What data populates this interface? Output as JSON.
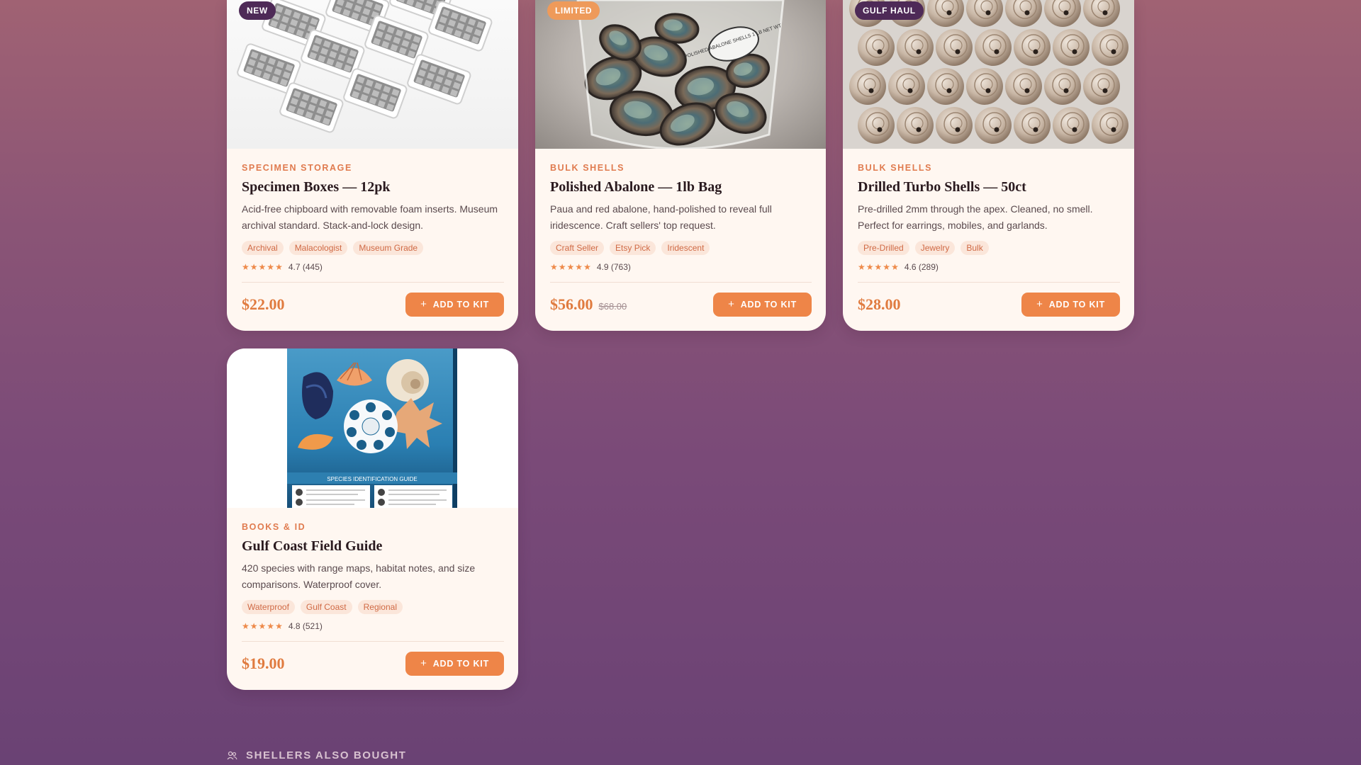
{
  "products": [
    {
      "badge": "NEW",
      "category": "SPECIMEN STORAGE",
      "title": "Specimen Boxes — 12pk",
      "description": "Acid-free chipboard with removable foam inserts. Museum archival standard. Stack-and-lock design.",
      "tags": [
        "Archival",
        "Malacologist",
        "Museum Grade"
      ],
      "rating": "4.7 (445)",
      "price": "$22.00",
      "old_price": "",
      "button": "ADD TO KIT"
    },
    {
      "badge": "LIMITED",
      "category": "BULK SHELLS",
      "title": "Polished Abalone — 1lb Bag",
      "description": "Paua and red abalone, hand-polished to reveal full iridescence. Craft sellers' top request.",
      "tags": [
        "Craft Seller",
        "Etsy Pick",
        "Iridescent"
      ],
      "rating": "4.9 (763)",
      "price": "$56.00",
      "old_price": "$68.00",
      "button": "ADD TO KIT"
    },
    {
      "badge": "GULF HAUL",
      "category": "BULK SHELLS",
      "title": "Drilled Turbo Shells — 50ct",
      "description": "Pre-drilled 2mm through the apex. Cleaned, no smell. Perfect for earrings, mobiles, and garlands.",
      "tags": [
        "Pre-Drilled",
        "Jewelry",
        "Bulk"
      ],
      "rating": "4.6 (289)",
      "price": "$28.00",
      "old_price": "",
      "button": "ADD TO KIT"
    },
    {
      "badge": "",
      "category": "BOOKS & ID",
      "title": "Gulf Coast Field Guide",
      "description": "420 species with range maps, habitat notes, and size comparisons. Waterproof cover.",
      "tags": [
        "Waterproof",
        "Gulf Coast",
        "Regional"
      ],
      "rating": "4.8 (521)",
      "price": "$19.00",
      "old_price": "",
      "button": "ADD TO KIT"
    }
  ],
  "book_cover_text": "SPECIES IDENTIFICATION GUIDE",
  "bag_label": "POLISHED ABALONE SHELLS 1 LB NET WT",
  "section_heading": "SHELLERS ALSO BOUGHT",
  "colors": {
    "accent": "#ee8548",
    "badge_dark": "#4e2a57",
    "badge_light": "#ee9a5a",
    "card_bg": "#fff7f1"
  }
}
